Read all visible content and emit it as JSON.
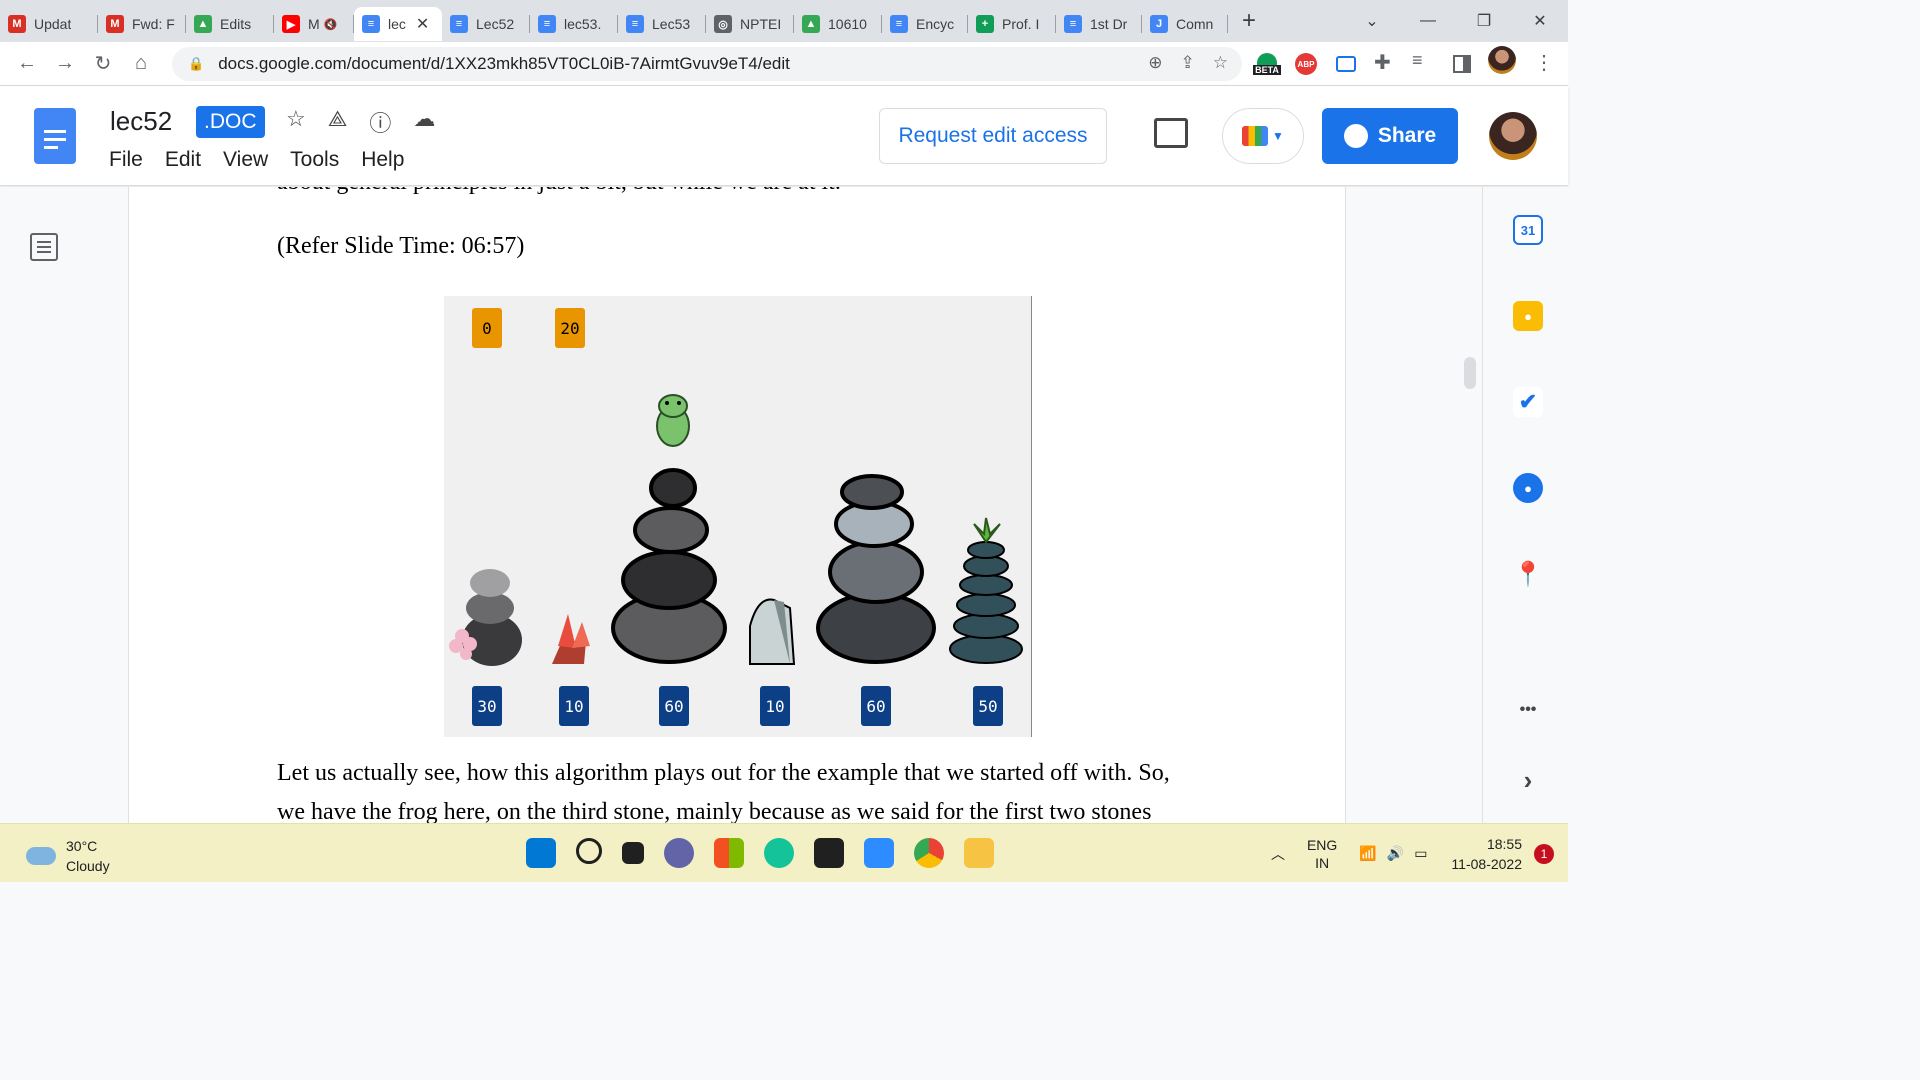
{
  "tabs": [
    {
      "title": "Updat",
      "icon": "gmail-icon",
      "color": "#d93025",
      "glyph": "M"
    },
    {
      "title": "Fwd: F",
      "icon": "gmail-icon",
      "color": "#d93025",
      "glyph": "M"
    },
    {
      "title": "Edits",
      "icon": "google-drive-icon",
      "color": "#34a853",
      "glyph": "▲"
    },
    {
      "title": "M",
      "icon": "youtube-icon",
      "color": "#ff0000",
      "glyph": "▶",
      "muted": "🔇"
    },
    {
      "title": "lec",
      "icon": "google-docs-icon",
      "color": "#4285f4",
      "glyph": "≡",
      "active": true,
      "close": "✕"
    },
    {
      "title": "Lec52",
      "icon": "google-docs-icon",
      "color": "#4285f4",
      "glyph": "≡"
    },
    {
      "title": "lec53.",
      "icon": "google-docs-icon",
      "color": "#4285f4",
      "glyph": "≡"
    },
    {
      "title": "Lec53",
      "icon": "google-docs-icon",
      "color": "#4285f4",
      "glyph": "≡"
    },
    {
      "title": "NPTEI",
      "icon": "globe-icon",
      "color": "#5f6368",
      "glyph": "◎"
    },
    {
      "title": "10610",
      "icon": "google-drive-icon",
      "color": "#34a853",
      "glyph": "▲"
    },
    {
      "title": "Encyc",
      "icon": "google-docs-icon",
      "color": "#4285f4",
      "glyph": "≡"
    },
    {
      "title": "Prof. I",
      "icon": "google-sheets-icon",
      "color": "#0f9d58",
      "glyph": "+"
    },
    {
      "title": "1st Dr",
      "icon": "google-docs-icon",
      "color": "#4285f4",
      "glyph": "≡"
    },
    {
      "title": "Comn",
      "icon": "jamboard-icon",
      "color": "#4285f4",
      "glyph": "J"
    }
  ],
  "browser": {
    "url": "docs.google.com/document/d/1XX23mkh85VT0CL0iB-7AirmtGvuv9eT4/edit",
    "new_tab": "+",
    "beta_label": "BETA",
    "abp_label": "ABP"
  },
  "doc": {
    "title": "lec52",
    "badge": ".DOC",
    "menu": [
      "File",
      "Edit",
      "View",
      "Tools",
      "Help"
    ],
    "request_access": "Request edit access",
    "share": "Share",
    "line_top": "about general principles in just a bit, but while we are at it.",
    "refer": "(Refer Slide Time: 06:57)",
    "para1": "Let us actually see, how this algorithm plays out for the example that we started off with. So,",
    "para2": "we have the frog here, on the third stone, mainly because as we said for the first two stones"
  },
  "slide": {
    "top_values": [
      "0",
      "20"
    ],
    "bottom_values": [
      "30",
      "10",
      "60",
      "10",
      "60",
      "50"
    ],
    "top_color": "#e89500",
    "bottom_color": "#0d3f86"
  },
  "side_panel": {
    "calendar_day": "31",
    "more": "•••",
    "expand": "›"
  },
  "taskbar": {
    "temp": "30°C",
    "condition": "Cloudy",
    "lang1": "ENG",
    "lang2": "IN",
    "time": "18:55",
    "date": "11-08-2022",
    "notif_count": "1"
  }
}
